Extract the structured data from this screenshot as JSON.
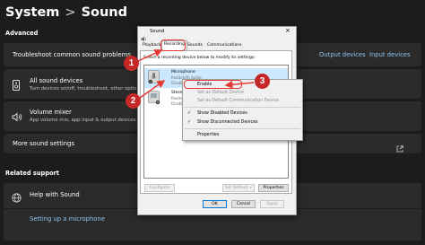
{
  "breadcrumb": {
    "parent": "System",
    "separator": ">",
    "current": "Sound"
  },
  "advanced_header": "Advanced",
  "cards": {
    "troubleshoot": {
      "title": "Troubleshoot common sound problems",
      "link1": "Output devices",
      "link2": "Input devices"
    },
    "all_devices": {
      "title": "All sound devices",
      "subtitle": "Turn devices on/off, troubleshoot, other options"
    },
    "volume_mixer": {
      "title": "Volume mixer",
      "subtitle": "App volume mix, app input & output devices"
    },
    "more_settings": {
      "title": "More sound settings"
    }
  },
  "related_header": "Related support",
  "help": {
    "title": "Help with Sound",
    "link": "Setting up a microphone"
  },
  "dialog": {
    "title": "Sound",
    "close": "×",
    "tabs": [
      "Playback",
      "Recording",
      "Sounds",
      "Communications"
    ],
    "instruction": "Select a recording device below to modify its settings:",
    "devices": [
      {
        "name": "Microphone",
        "sub1": "Realtek(R) Audio",
        "sub2": "Disabled"
      },
      {
        "name": "Stereo Mix",
        "sub1": "Realtek(R) Audio",
        "sub2": "Disabled"
      }
    ],
    "buttons": {
      "configure": "Configure",
      "set_default": "Set Default ∨",
      "properties": "Properties",
      "ok": "OK",
      "cancel": "Cancel",
      "apply": "Apply"
    }
  },
  "context_menu": {
    "items": [
      "Enable",
      "Set as Default Device",
      "Set as Default Communication Device",
      "Show Disabled Devices",
      "Show Disconnected Devices",
      "Properties"
    ],
    "check": "✓"
  },
  "annotations": [
    "1",
    "2",
    "3"
  ],
  "colors": {
    "accent": "#8ec5f2",
    "annotation": "#c62828",
    "selection": "#cce8ff"
  }
}
